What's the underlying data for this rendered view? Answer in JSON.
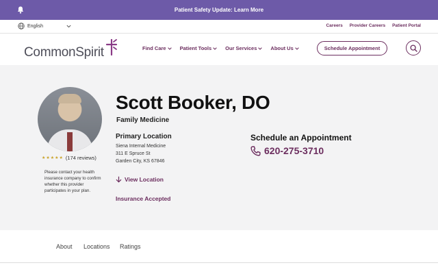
{
  "alert": {
    "text": "Patient Safety Update: Learn More",
    "icon": "bell-icon"
  },
  "utility": {
    "language": "English",
    "links": [
      "Careers",
      "Provider Careers",
      "Patient Portal"
    ]
  },
  "nav": {
    "logo_text": "CommonSpirit",
    "items": [
      "Find Care",
      "Patient Tools",
      "Our Services",
      "About Us"
    ],
    "appointment_button": "Schedule Appointment"
  },
  "provider": {
    "name": "Scott Booker, DO",
    "specialty": "Family Medicine",
    "rating_stars": 5,
    "reviews": "(174 reviews)",
    "insurance_note": "Please contact your health insurance company to confirm whether this provider participates in your plan.",
    "location_heading": "Primary Location",
    "location_name": "Siena Internal Medicine",
    "address_line1": "311 E Spruce St",
    "address_line2": "Garden City, KS 67846",
    "view_location": "View Location",
    "insurance_accepted": "Insurance Accepted"
  },
  "schedule": {
    "heading": "Schedule an Appointment",
    "phone": "620-275-3710"
  },
  "tabs": [
    "About",
    "Locations",
    "Ratings"
  ],
  "colors": {
    "brand": "#6b2d5e",
    "banner": "#6d5aa8",
    "hero_bg": "#f3f3f4"
  }
}
